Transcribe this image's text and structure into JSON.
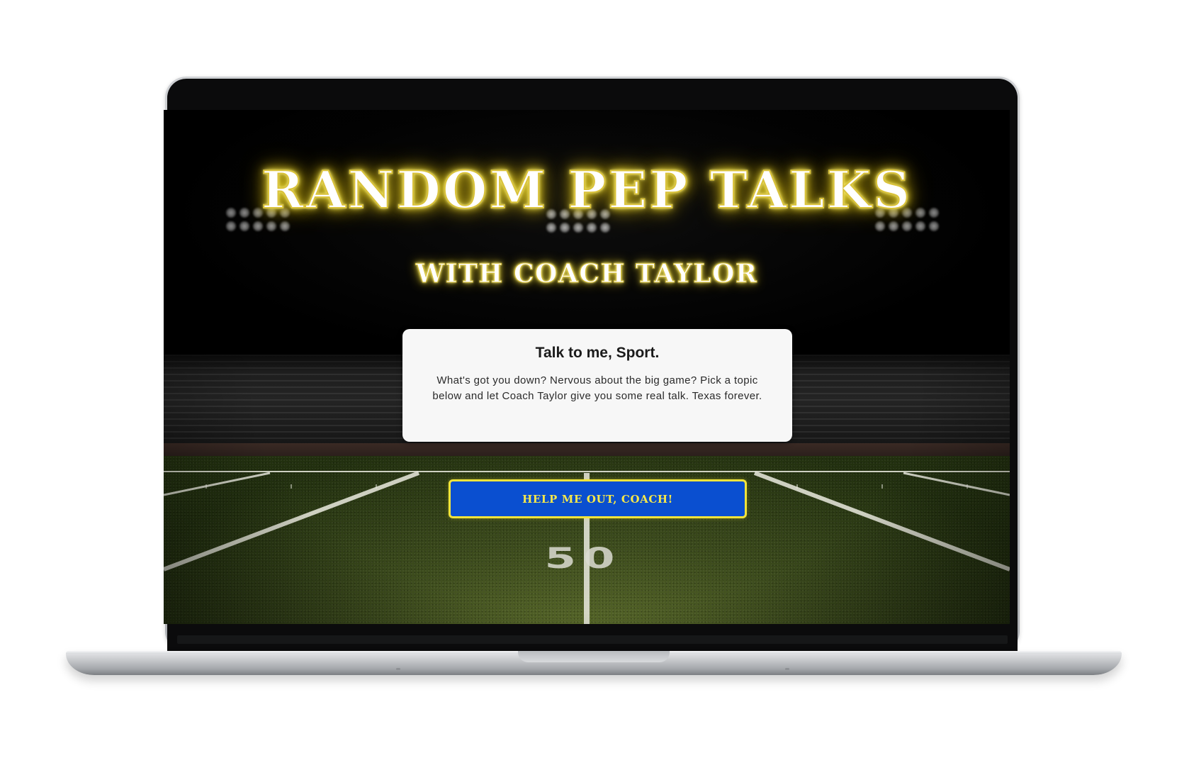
{
  "device": {
    "icon": "laptop-frame"
  },
  "hero": {
    "title": "RANDOM PEP TALKS",
    "subtitle": "WITH COACH TAYLOR",
    "glow_color": "#f2e23c"
  },
  "card": {
    "title": "Talk to me, Sport.",
    "body": "What's got you down? Nervous about the big game? Pick a topic below and let Coach Taylor give you some real talk. Texas forever."
  },
  "cta": {
    "label": "HELP ME OUT, COACH!",
    "background_color": "#0a4fd0",
    "border_color": "#f2e43a"
  },
  "background": {
    "scene": "football-stadium-at-night",
    "yard_marker": "50"
  }
}
